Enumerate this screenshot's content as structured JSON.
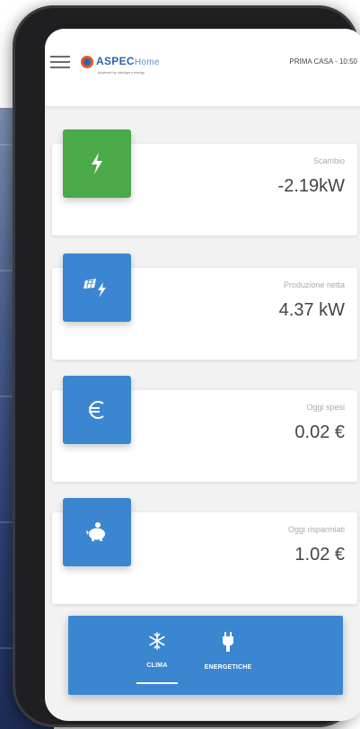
{
  "header": {
    "brand": "ASPEC",
    "brand_suffix": "Home",
    "tagline": "powered by intelligent energy",
    "status": "PRIMA CASA - 10:50"
  },
  "cards": [
    {
      "label": "Scambio",
      "value": "-2.19kW",
      "icon": "lightning-icon",
      "color": "#4aaa4a"
    },
    {
      "label": "Produzione netta",
      "value": "4.37 kW",
      "icon": "solar-panel-icon",
      "color": "#3b86d0"
    },
    {
      "label": "Oggi spesi",
      "value": "0.02 €",
      "icon": "euro-icon",
      "color": "#3b86d0"
    },
    {
      "label": "Oggi risparmiati",
      "value": "1.02 €",
      "icon": "piggy-bank-icon",
      "color": "#3b86d0"
    }
  ],
  "nav": {
    "items": [
      {
        "label": "CLIMA",
        "icon": "snowflake-icon",
        "active": true
      },
      {
        "label": "ENERGETICHE",
        "icon": "plug-icon",
        "active": false
      }
    ]
  },
  "colors": {
    "accent": "#3b86d0",
    "green": "#4aaa4a",
    "background": "#f2f2f2"
  }
}
